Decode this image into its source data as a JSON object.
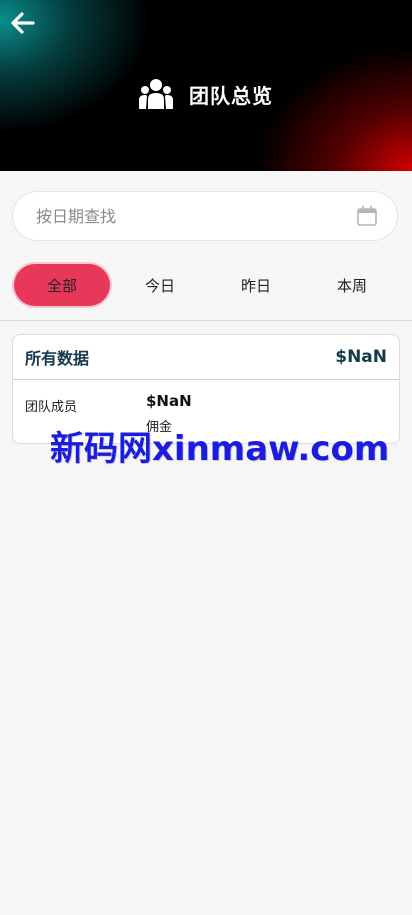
{
  "header": {
    "title": "团队总览",
    "back_icon": "arrow-left-icon",
    "team_icon": "team-icon"
  },
  "search": {
    "placeholder": "按日期查找",
    "icon": "calendar-icon"
  },
  "tabs": [
    {
      "label": "全部",
      "active": true
    },
    {
      "label": "今日",
      "active": false
    },
    {
      "label": "昨日",
      "active": false
    },
    {
      "label": "本周",
      "active": false
    }
  ],
  "summary": {
    "title": "所有数据",
    "total": "$NaN",
    "row_label": "团队成员",
    "row_value": "$NaN",
    "row_sub": "佣金"
  },
  "watermark": "新码网xinmaw.com",
  "colors": {
    "accent": "#e8385a",
    "title_color": "#16394e",
    "watermark": "#1c1ce0"
  }
}
